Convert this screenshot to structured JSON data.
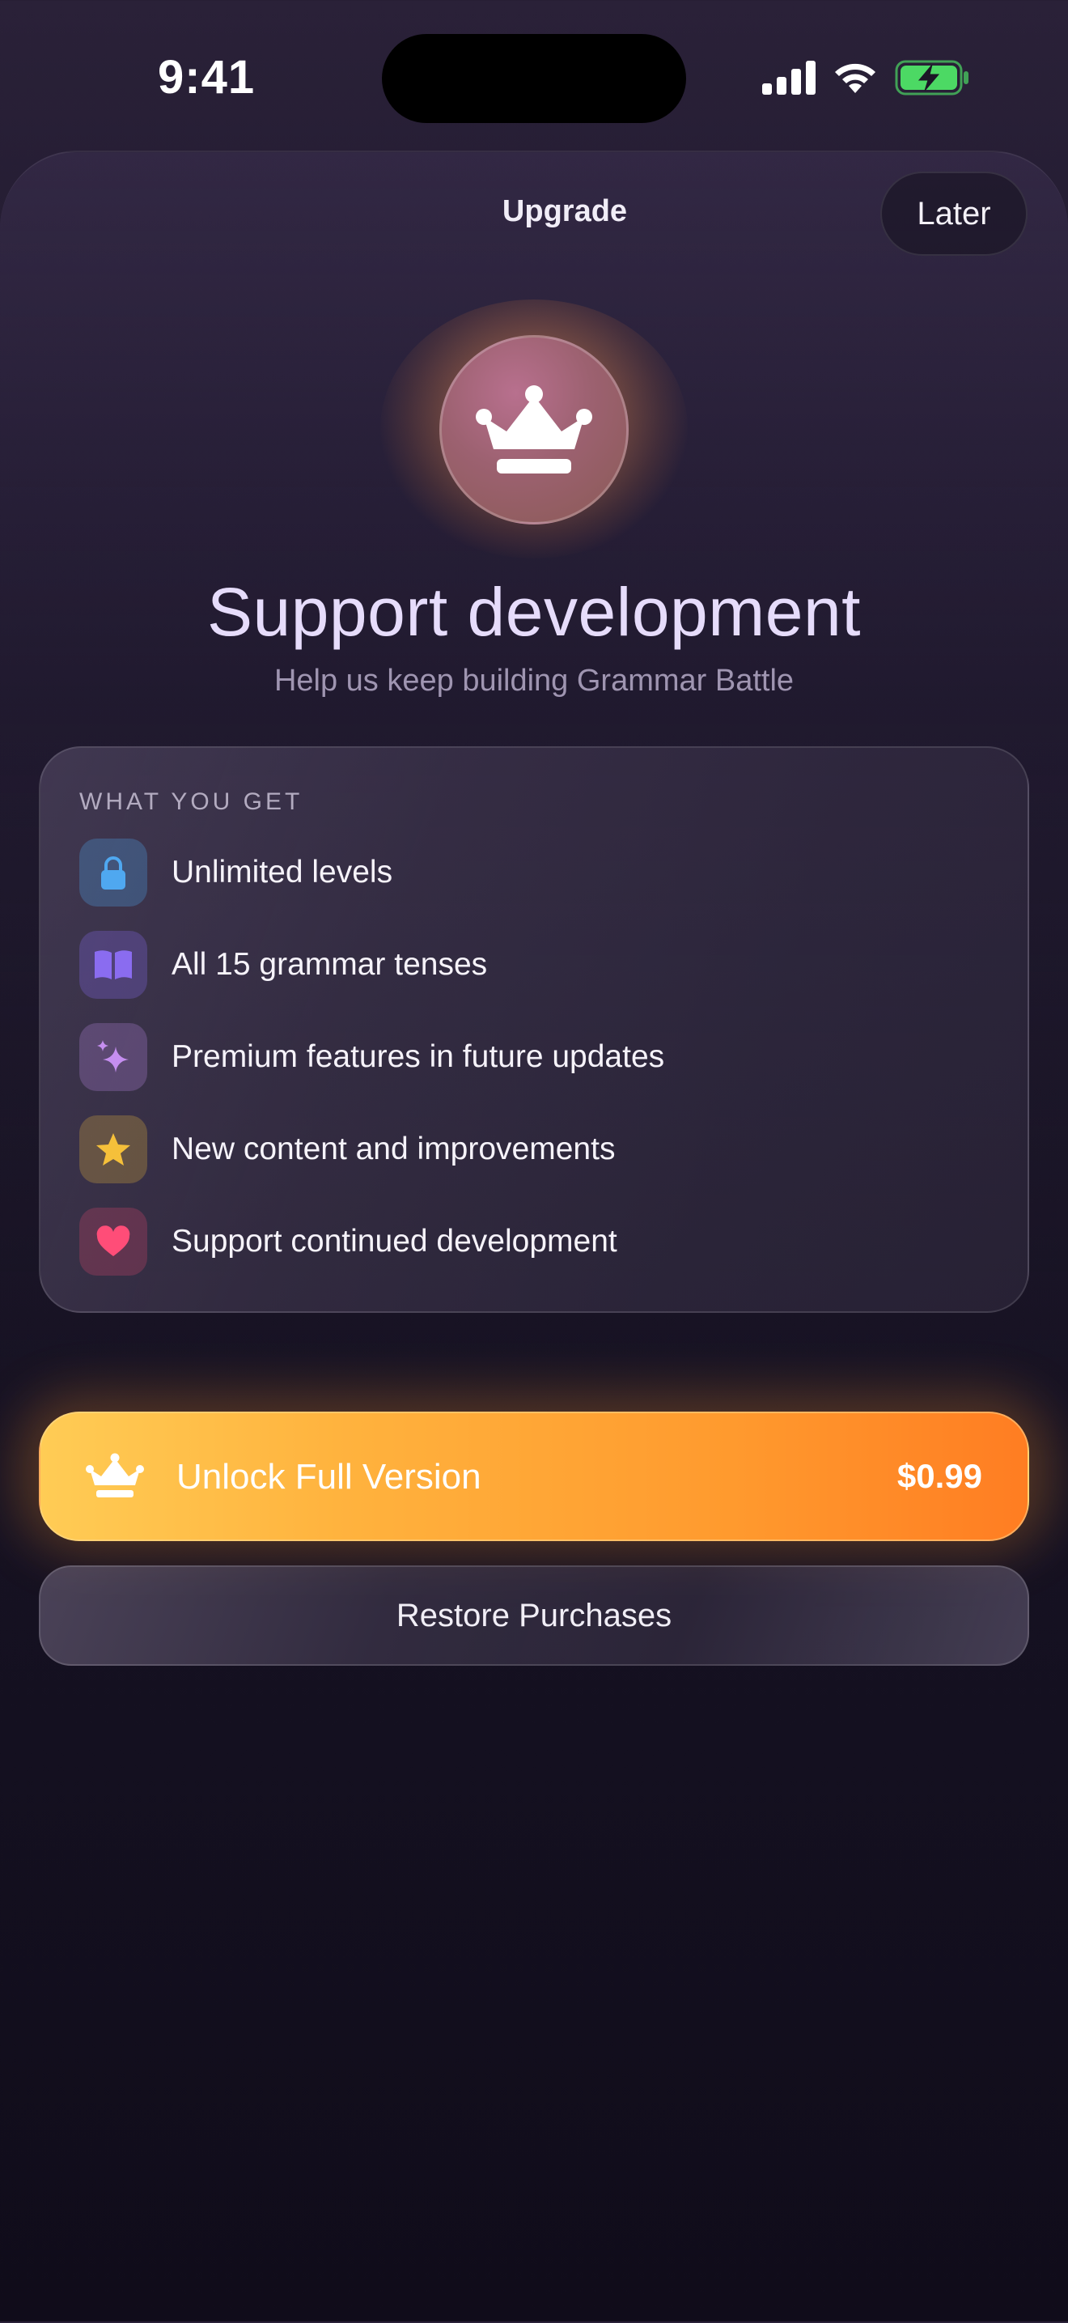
{
  "status_bar": {
    "time": "9:41"
  },
  "header": {
    "title": "Upgrade",
    "later_label": "Later"
  },
  "hero": {
    "icon": "crown-icon",
    "headline": "Support development",
    "subheadline": "Help us keep building Grammar Battle"
  },
  "benefits": {
    "heading": "WHAT YOU GET",
    "items": [
      {
        "label": "Unlimited levels",
        "icon": "lock-icon",
        "color": "#4fa8f0"
      },
      {
        "label": "All 15 grammar tenses",
        "icon": "book-icon",
        "color": "#8a6cf0"
      },
      {
        "label": "Premium features in future updates",
        "icon": "sparkles-icon",
        "color": "#c58ef0"
      },
      {
        "label": "New content and improvements",
        "icon": "star-icon",
        "color": "#f5c03a"
      },
      {
        "label": "Support continued development",
        "icon": "heart-icon",
        "color": "#ff4d78"
      }
    ]
  },
  "purchase": {
    "unlock_label": "Unlock Full Version",
    "price": "$0.99",
    "restore_label": "Restore Purchases"
  },
  "colors": {
    "accent_orange": "#ff9a2e",
    "accent_yellow": "#ffcc55",
    "headline": "#e6dcfb",
    "battery_green": "#4cd964"
  }
}
